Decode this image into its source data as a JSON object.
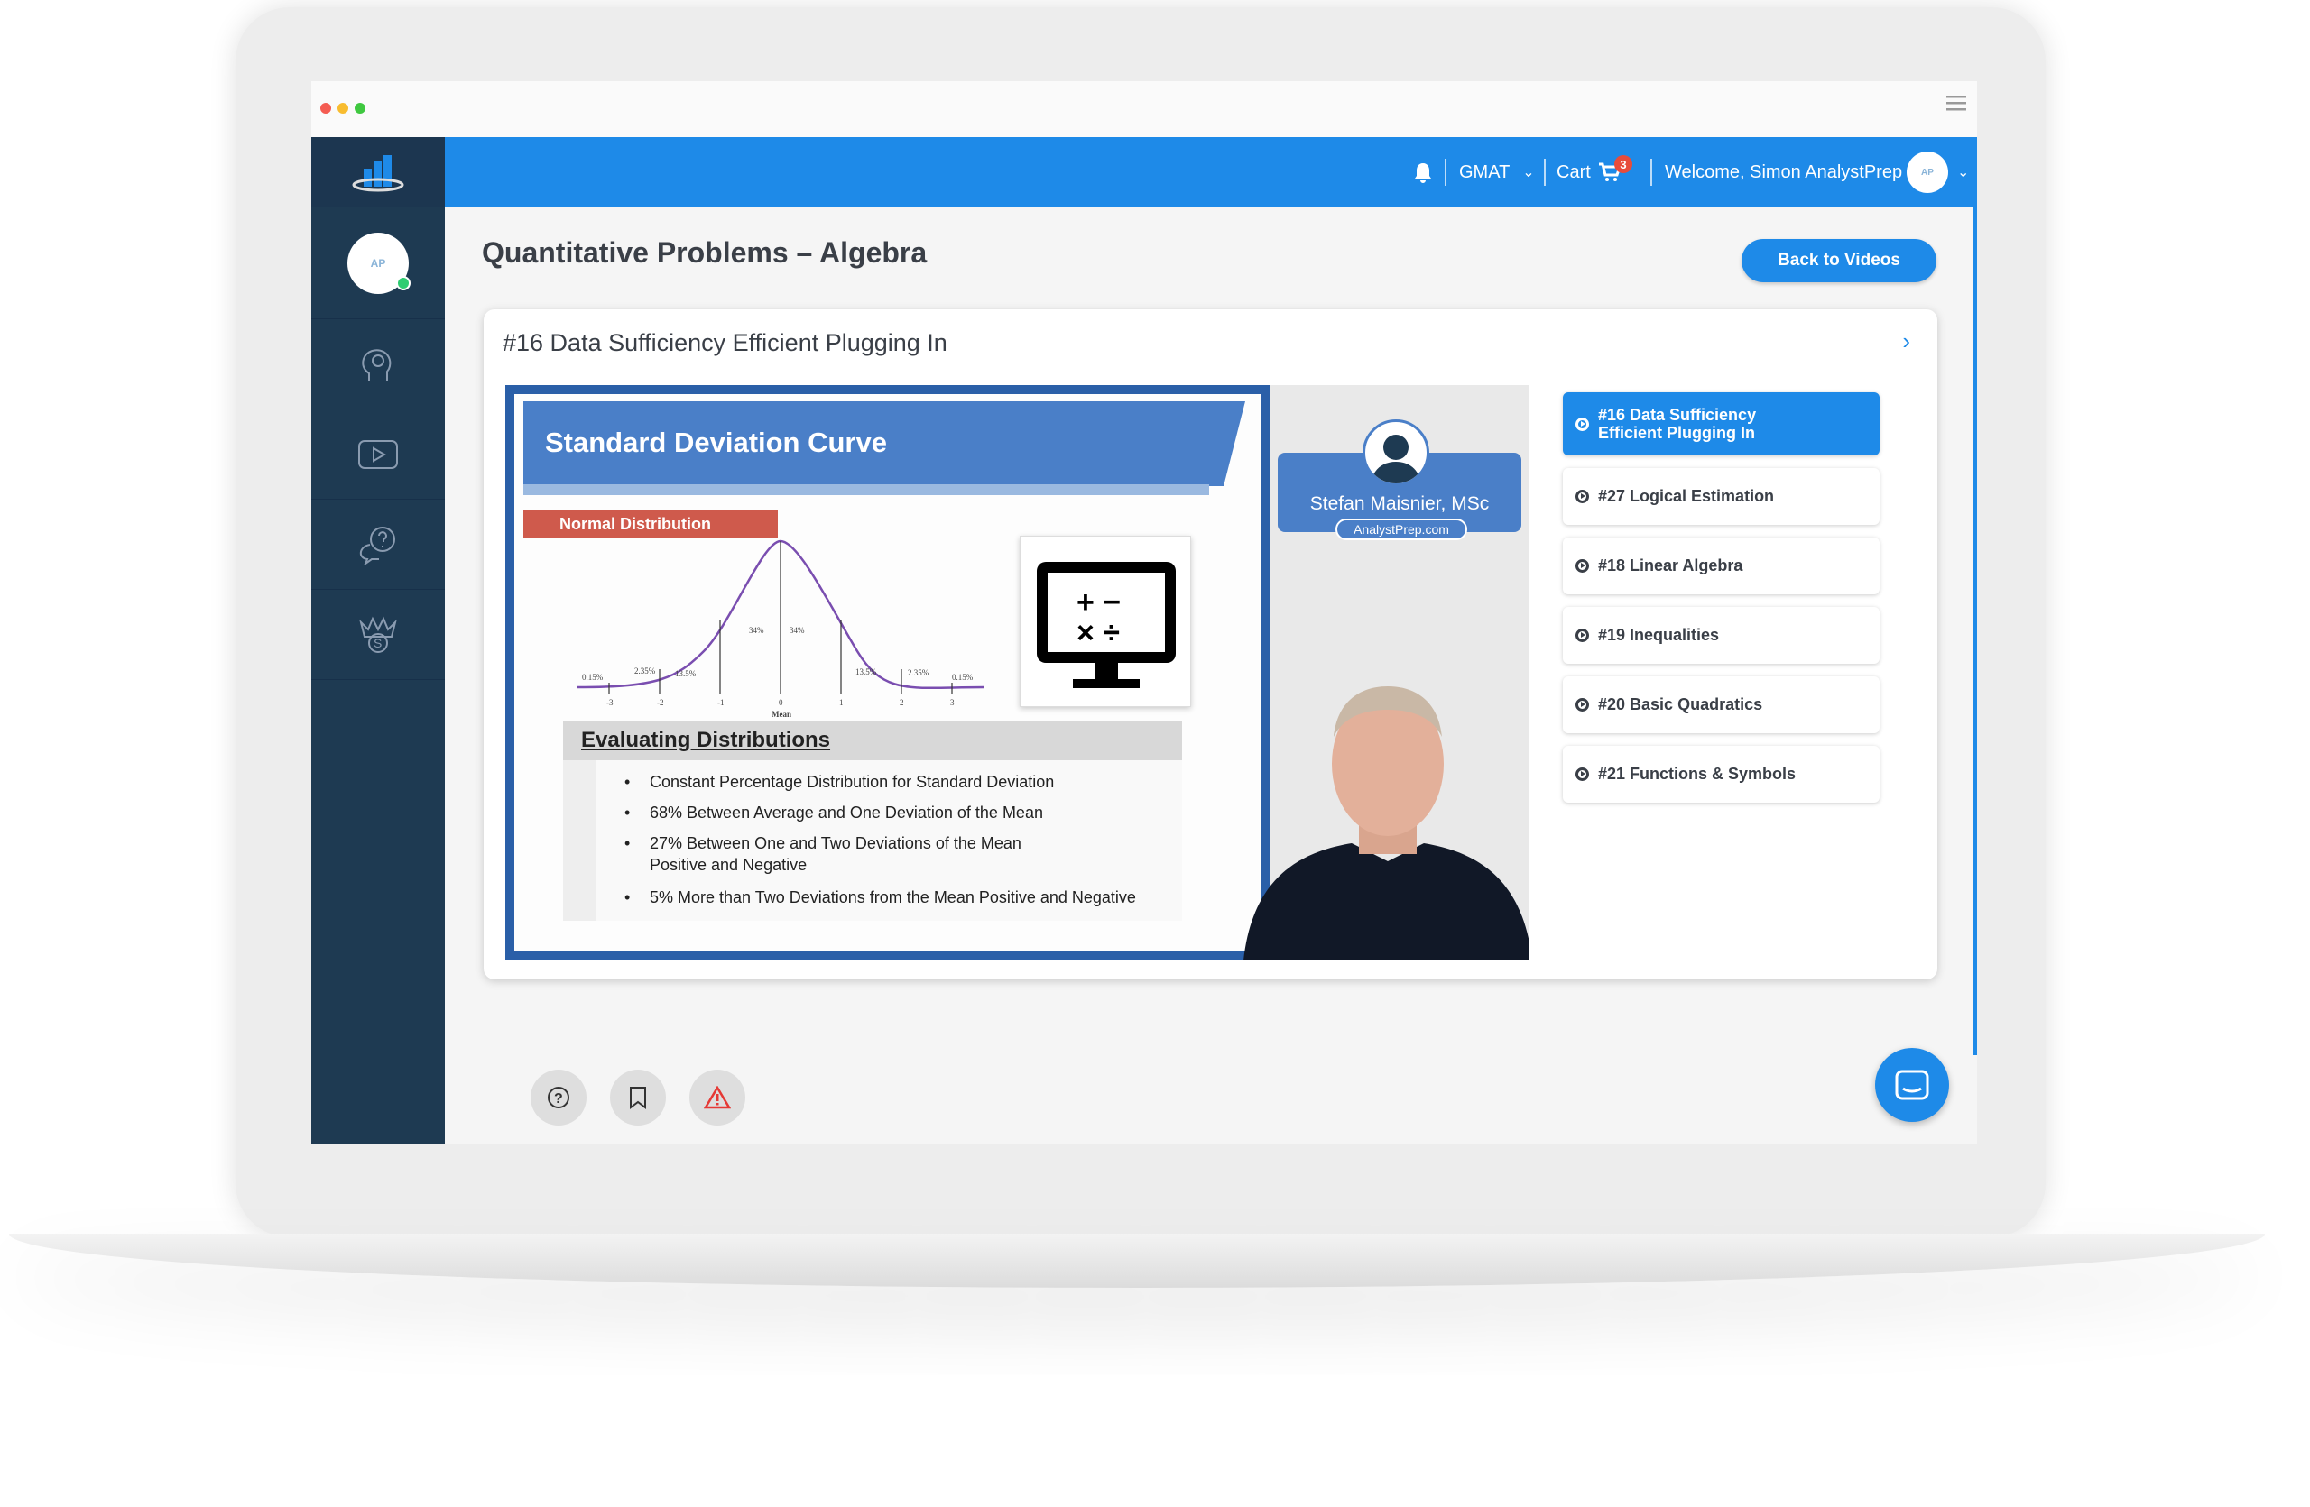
{
  "header": {
    "gmat_label": "GMAT",
    "cart_label": "Cart",
    "cart_count": "3",
    "welcome": "Welcome, Simon AnalystPrep",
    "accent": "#1e8ae8"
  },
  "sidebar": {
    "items": [
      {
        "icon": "mind-gear-icon"
      },
      {
        "icon": "video-play-icon"
      },
      {
        "icon": "question-chat-icon"
      },
      {
        "icon": "crown-coin-icon"
      }
    ],
    "color": "#1e3a52"
  },
  "page": {
    "title": "Quantitative Problems – Algebra",
    "back_button": "Back to Videos"
  },
  "video_card": {
    "title": "#16 Data Sufficiency Efficient Plugging In"
  },
  "video_frame": {
    "slide_title": "Standard Deviation Curve",
    "section_label": "Normal Distribution",
    "curve_labels": [
      "0.15%",
      "2.35%",
      "13.5%",
      "34%",
      "34%",
      "13.5%",
      "2.35%",
      "0.15%"
    ],
    "axis_ticks": [
      "-3",
      "-2",
      "-1",
      "0",
      "1",
      "2",
      "3"
    ],
    "axis_label": "Mean",
    "box_title": "Evaluating Distributions",
    "bullets": [
      "Constant Percentage Distribution for Standard Deviation",
      "68% Between Average and One Deviation of the Mean",
      "27% Between One and Two Deviations of the Mean",
      "Positive and Negative",
      "5% More than Two Deviations from the Mean Positive and Negative"
    ],
    "presenter_name": "Stefan Maisnier, MSc",
    "presenter_site": "AnalystPrep.com"
  },
  "playlist": [
    {
      "label": "#16 Data Sufficiency",
      "label2": "Efficient Plugging In",
      "active": true
    },
    {
      "label": "#27 Logical Estimation"
    },
    {
      "label": "#18 Linear Algebra"
    },
    {
      "label": "#19 Inequalities"
    },
    {
      "label": "#20 Basic Quadratics"
    },
    {
      "label": "#21 Functions & Symbols"
    }
  ],
  "actions": [
    {
      "icon": "help-icon"
    },
    {
      "icon": "bookmark-icon"
    },
    {
      "icon": "warning-icon"
    }
  ]
}
